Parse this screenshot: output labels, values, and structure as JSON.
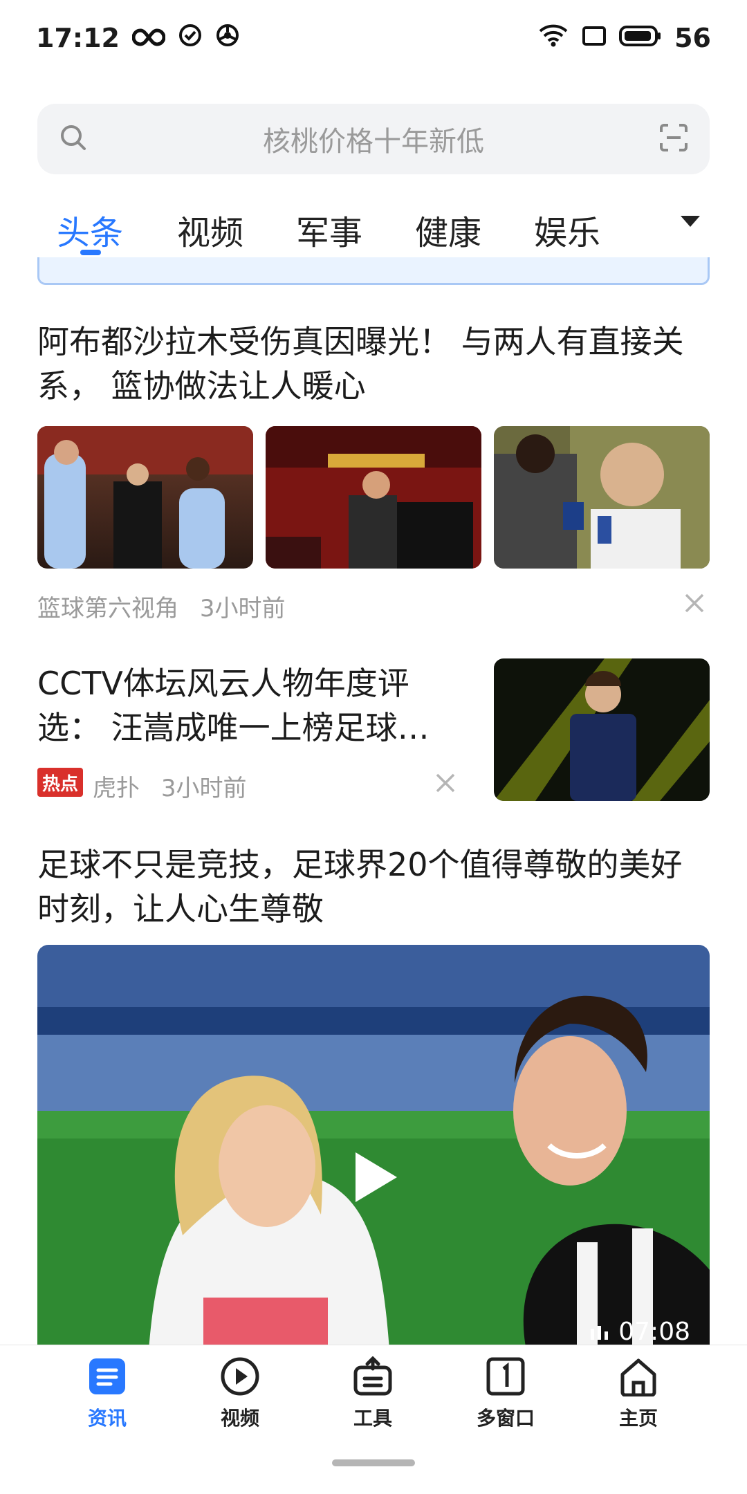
{
  "status_bar": {
    "time": "17:12",
    "battery": "56",
    "icons": [
      "infinity-icon",
      "check-circle-icon",
      "aperture-icon",
      "wifi-icon",
      "screen-icon",
      "battery-icon"
    ]
  },
  "search": {
    "placeholder": "核桃价格十年新低"
  },
  "tabs": [
    "头条",
    "视频",
    "军事",
    "健康",
    "娱乐"
  ],
  "feed": {
    "article1": {
      "title": "阿布都沙拉木受伤真因曝光！ 与两人有直接关系， 篮协做法让人暖心",
      "source": "篮球第六视角",
      "time": "3小时前"
    },
    "article2": {
      "title": "CCTV体坛风云人物年度评选： 汪嵩成唯一上榜足球…",
      "badge": "热点",
      "source": "虎扑",
      "time": "3小时前"
    },
    "article3": {
      "title": "足球不只是竞技，足球界20个值得尊敬的美好时刻，让人心生尊敬",
      "duration": "07:08"
    }
  },
  "bottom_nav": {
    "items": [
      {
        "label": "资讯",
        "icon": "news-icon"
      },
      {
        "label": "视频",
        "icon": "play-circle-icon"
      },
      {
        "label": "工具",
        "icon": "toolbox-icon"
      },
      {
        "label": "多窗口",
        "icon": "multi-window-icon"
      },
      {
        "label": "主页",
        "icon": "home-icon"
      }
    ]
  },
  "colors": {
    "accent": "#2878ff",
    "hot_badge": "#d9302b",
    "text_secondary": "#9a9a9a"
  }
}
